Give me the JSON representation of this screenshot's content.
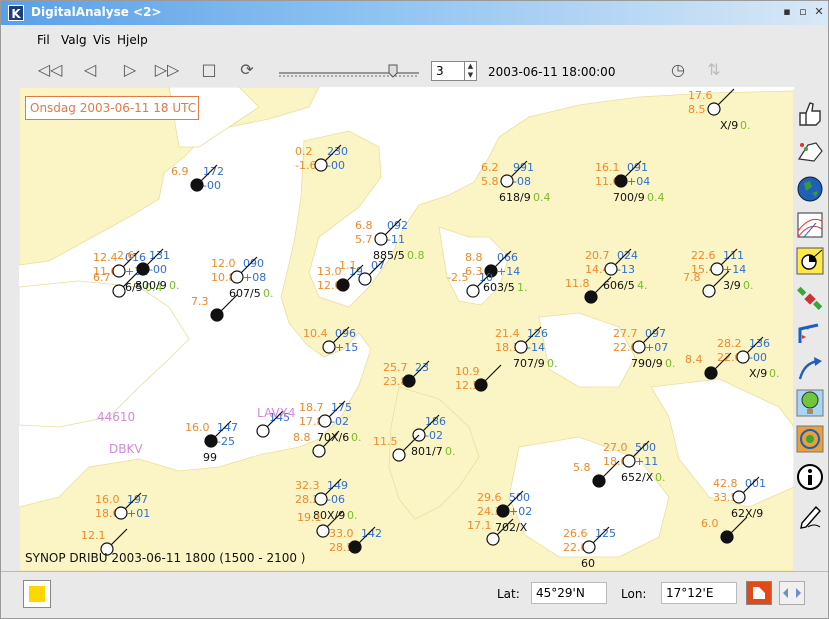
{
  "window": {
    "title": "DigitalAnalyse <2>",
    "logo": "K",
    "controls": [
      "minimize-icon",
      "maximize-icon",
      "close-icon"
    ]
  },
  "menu": {
    "items": [
      "Fil",
      "Valg",
      "Vis",
      "Hjelp"
    ]
  },
  "toolbar": {
    "spin_value": "3",
    "time": "2003-06-11 18:00:00"
  },
  "map": {
    "date_label": "Onsdag 2003-06-11 18 UTC",
    "footer": "SYNOP DRIBU 2003-06-11 1800 (1500 - 2100 )",
    "colors": {
      "sea": "#ffffff",
      "land": "#fbf5c6",
      "temp": "#ef8a2a",
      "pressure": "#2f6fd0",
      "cloud": "#7bbb2a",
      "ship": "#d38ad8"
    },
    "ship_ids": [
      {
        "text": "44610"
      },
      {
        "text": "LAVX4"
      },
      {
        "text": "DBKV"
      }
    ],
    "stations": [
      {
        "t": "6.9",
        "td": "",
        "p": "172",
        "dp": "-00",
        "cl": "",
        "n": "",
        "vis": ""
      },
      {
        "t": "0.2",
        "td": "-1.6",
        "p": "230",
        "dp": "-00",
        "cl": "",
        "n": "",
        "vis": ""
      },
      {
        "t": "6.2",
        "td": "5.8",
        "p": "991",
        "dp": "-08",
        "cl": "8/9",
        "n": "0.4",
        "vis": "61"
      },
      {
        "t": "16.1",
        "td": "11.6",
        "p": "091",
        "dp": "+04",
        "cl": "0/9",
        "n": "0.4",
        "vis": "70"
      },
      {
        "t": "17.6",
        "td": "8.5",
        "p": "",
        "dp": "",
        "cl": "X/9",
        "n": "0.",
        "vis": ""
      },
      {
        "t": "12.4",
        "td": "11.6",
        "p": "016",
        "dp": "+32",
        "cl": "6/5",
        "n": "0.4",
        "vis": ""
      },
      {
        "t": "2.6",
        "td": "",
        "p": "131",
        "dp": "-00",
        "cl": "0/9",
        "n": "0.",
        "vis": "80"
      },
      {
        "t": "6.7",
        "td": "",
        "p": "",
        "dp": "",
        "cl": "",
        "n": "",
        "vis": ""
      },
      {
        "t": "12.0",
        "td": "10.8",
        "p": "090",
        "dp": "+08",
        "cl": "7/5",
        "n": "0.",
        "vis": "60"
      },
      {
        "t": "7.3",
        "td": "",
        "p": "",
        "dp": "",
        "cl": "",
        "n": "",
        "vis": ""
      },
      {
        "t": "6.8",
        "td": "5.7",
        "p": "092",
        "dp": "-11",
        "cl": "5/5",
        "n": "0.8",
        "vis": "88"
      },
      {
        "t": "1.1",
        "td": "",
        "p": "07",
        "dp": "",
        "cl": "",
        "n": "",
        "vis": ""
      },
      {
        "t": "8.8",
        "td": "6.3",
        "p": "066",
        "dp": "+14",
        "cl": "3/5",
        "n": "1.",
        "vis": "60"
      },
      {
        "t": "-2.5",
        "td": "",
        "p": "10",
        "dp": "",
        "cl": "",
        "n": "",
        "vis": ""
      },
      {
        "t": "20.7",
        "td": "14.4",
        "p": "024",
        "dp": "-13",
        "cl": "6/5",
        "n": "4.",
        "vis": "60"
      },
      {
        "t": "11.8",
        "td": "",
        "p": "",
        "dp": "",
        "cl": "",
        "n": "",
        "vis": ""
      },
      {
        "t": "22.6",
        "td": "15.4",
        "p": "111",
        "dp": "+14",
        "cl": "3/9",
        "n": "0.",
        "vis": ""
      },
      {
        "t": "7.8",
        "td": "",
        "p": "",
        "dp": "",
        "cl": "",
        "n": "",
        "vis": ""
      },
      {
        "t": "13.0",
        "td": "12.0",
        "p": "19",
        "dp": "",
        "cl": "",
        "n": "",
        "vis": ""
      },
      {
        "t": "10.4",
        "td": "",
        "p": "096",
        "dp": "+15",
        "cl": "",
        "n": "",
        "vis": ""
      },
      {
        "t": "21.4",
        "td": "18.1",
        "p": "126",
        "dp": "-14",
        "cl": "7/9",
        "n": "0.",
        "vis": "70"
      },
      {
        "t": "10.9",
        "td": "12.5",
        "p": "",
        "dp": "",
        "cl": "",
        "n": "",
        "vis": ""
      },
      {
        "t": "27.7",
        "td": "22.0",
        "p": "097",
        "dp": "+07",
        "cl": "0/9",
        "n": "0.",
        "vis": "79"
      },
      {
        "t": "28.2",
        "td": "22.0",
        "p": "136",
        "dp": "-00",
        "cl": "X/9",
        "n": "0.",
        "vis": ""
      },
      {
        "t": "8.4",
        "td": "",
        "p": "",
        "dp": "",
        "cl": "",
        "n": "",
        "vis": ""
      },
      {
        "t": "18.7",
        "td": "17.8",
        "p": "175",
        "dp": "-02",
        "cl": "X/6",
        "n": "0.",
        "vis": "70"
      },
      {
        "t": "8.8",
        "td": "",
        "p": "",
        "dp": "",
        "cl": "",
        "n": "",
        "vis": ""
      },
      {
        "t": "25.7",
        "td": "23.8",
        "p": "23",
        "dp": "",
        "cl": "",
        "n": "",
        "vis": ""
      },
      {
        "t": "",
        "td": "",
        "p": "186",
        "dp": "-02",
        "cl": "1/7",
        "n": "0.",
        "vis": "80"
      },
      {
        "t": "11.5",
        "td": "",
        "p": "",
        "dp": "",
        "cl": "",
        "n": "",
        "vis": ""
      },
      {
        "t": "16.0",
        "td": "",
        "p": "147",
        "dp": "-25",
        "cl": "",
        "n": "",
        "vis": "99"
      },
      {
        "t": "",
        "td": "",
        "p": "145",
        "dp": "",
        "cl": "",
        "n": "",
        "vis": ""
      },
      {
        "t": "27.0",
        "td": "18.0",
        "p": "500",
        "dp": "+11",
        "cl": "2/X",
        "n": "0.",
        "vis": "65"
      },
      {
        "t": "5.8",
        "td": "",
        "p": "",
        "dp": "",
        "cl": "",
        "n": "",
        "vis": ""
      },
      {
        "t": "32.3",
        "td": "28.2",
        "p": "149",
        "dp": "-06",
        "cl": "X/9",
        "n": "0.",
        "vis": "80"
      },
      {
        "t": "19.1",
        "td": "",
        "p": "",
        "dp": "",
        "cl": "",
        "n": "",
        "vis": ""
      },
      {
        "t": "29.6",
        "td": "24.3",
        "p": "500",
        "dp": "+02",
        "cl": "2/X",
        "n": "",
        "vis": "70"
      },
      {
        "t": "17.1",
        "td": "",
        "p": "",
        "dp": "",
        "cl": "",
        "n": "",
        "vis": ""
      },
      {
        "t": "42.8",
        "td": "33.5",
        "p": "001",
        "dp": "",
        "cl": "X/9",
        "n": "",
        "vis": "62"
      },
      {
        "t": "6.0",
        "td": "",
        "p": "",
        "dp": "",
        "cl": "",
        "n": "",
        "vis": ""
      },
      {
        "t": "16.0",
        "td": "18.6",
        "p": "197",
        "dp": "+01",
        "cl": "",
        "n": "",
        "vis": ""
      },
      {
        "t": "12.1",
        "td": "",
        "p": "",
        "dp": "",
        "cl": "",
        "n": "",
        "vis": ""
      },
      {
        "t": "33.0",
        "td": "28.5",
        "p": "142",
        "dp": "",
        "cl": "",
        "n": "",
        "vis": ""
      },
      {
        "t": "26.6",
        "td": "22.0",
        "p": "125",
        "dp": "",
        "cl": "",
        "n": "",
        "vis": "60"
      }
    ]
  },
  "status": {
    "lat_label": "Lat:",
    "lat_value": "45°29'N",
    "lon_label": "Lon:",
    "lon_value": "17°12'E"
  }
}
